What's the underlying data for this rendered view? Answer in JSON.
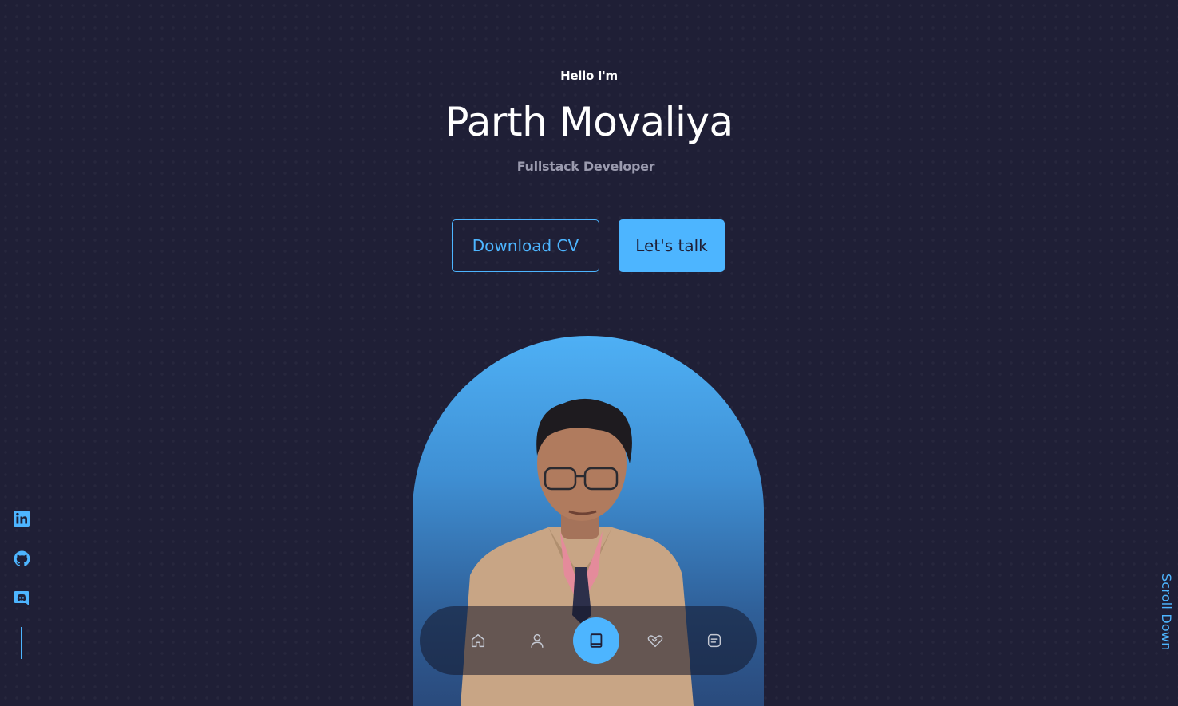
{
  "hero": {
    "greeting": "Hello I'm",
    "name": "Parth Movaliya",
    "role": "Fullstack Developer",
    "download_cv_label": "Download CV",
    "lets_talk_label": "Let's talk"
  },
  "portrait": {
    "alt": "Portrait photo"
  },
  "socials": [
    {
      "icon": "linkedin-icon"
    },
    {
      "icon": "github-icon"
    },
    {
      "icon": "discord-icon"
    }
  ],
  "scroll_down_label": "Scroll Down",
  "nav": {
    "items": [
      {
        "icon": "home-icon",
        "active": false
      },
      {
        "icon": "user-icon",
        "active": false
      },
      {
        "icon": "book-icon",
        "active": true
      },
      {
        "icon": "handshake-icon",
        "active": false
      },
      {
        "icon": "message-icon",
        "active": false
      }
    ]
  },
  "colors": {
    "background": "#1f1f36",
    "accent": "#4db5ff",
    "muted_text": "#9a9aae",
    "text": "#ffffff"
  }
}
